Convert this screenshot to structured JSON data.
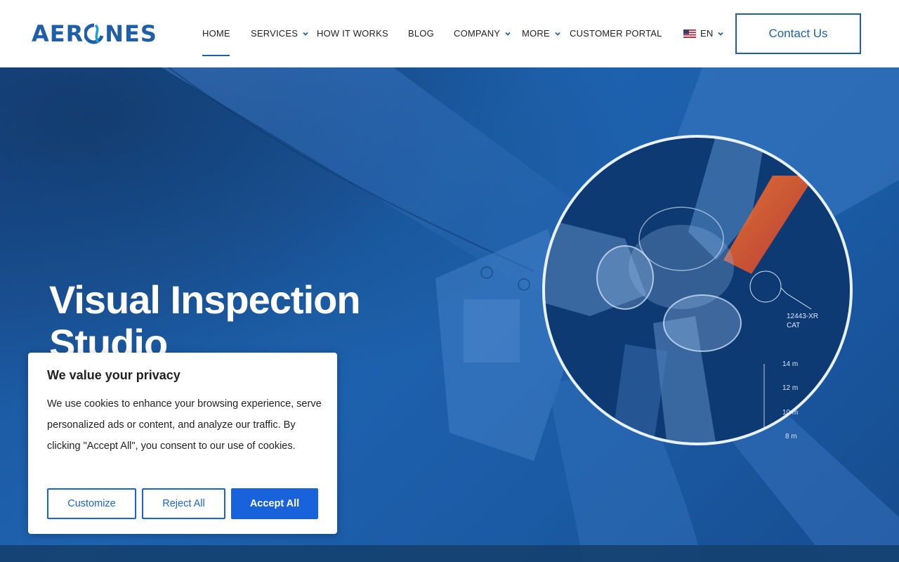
{
  "brand": {
    "logo_text_left": "AER",
    "logo_text_right": "NES",
    "accent": "#1f5fa8"
  },
  "nav": {
    "items": [
      {
        "label": "HOME",
        "active": true,
        "dropdown": false
      },
      {
        "label": "SERVICES",
        "dropdown": true
      },
      {
        "label": "HOW IT WORKS",
        "dropdown": false
      },
      {
        "label": "BLOG",
        "dropdown": false
      },
      {
        "label": "COMPANY",
        "dropdown": true
      },
      {
        "label": "MORE",
        "dropdown": true
      },
      {
        "label": "CUSTOMER PORTAL",
        "dropdown": false
      }
    ],
    "language": "EN",
    "contact_label": "Contact Us"
  },
  "hero": {
    "title_line1": "Visual Inspection",
    "title_line2": "Studio",
    "annotation_id": "12443-XR",
    "annotation_cat": "CAT",
    "scale_labels": [
      "14 m",
      "12 m",
      "10 m",
      "8 m"
    ]
  },
  "cookie": {
    "title": "We value your privacy",
    "text": "We use cookies to enhance your browsing experience, serve personalized ads or content, and analyze our traffic. By clicking \"Accept All\", you consent to our use of cookies.",
    "customize_label": "Customize",
    "reject_label": "Reject All",
    "accept_label": "Accept All",
    "accent": "#1863dc"
  }
}
